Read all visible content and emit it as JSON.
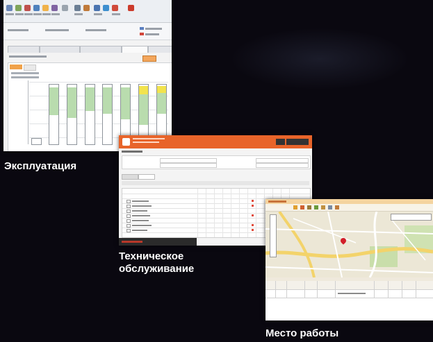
{
  "captions": {
    "operations": "Эксплуатация",
    "maintenance_line1": "Техническое",
    "maintenance_line2": "обслуживание",
    "workplace": "Место работы"
  },
  "colors": {
    "background": "#0a0810",
    "caption": "#ffffff",
    "accent_orange": "#e8642a",
    "bar_green": "#b9dcae",
    "bar_yellow": "#f2e34d",
    "map_marker": "#d21f2a"
  },
  "icons": [
    "toolbar-icon",
    "map-marker-icon",
    "checkbox-icon"
  ]
}
